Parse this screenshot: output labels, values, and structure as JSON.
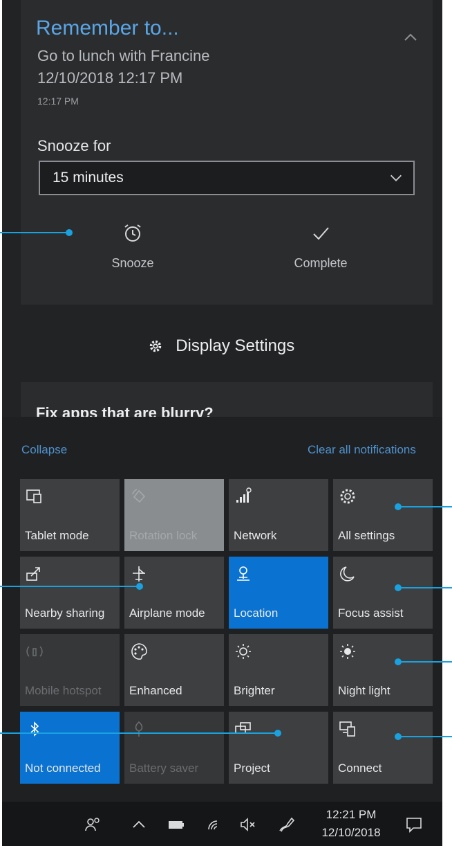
{
  "notification": {
    "title": "Remember to...",
    "line1": "Go to lunch with Francine",
    "line2": "12/10/2018 12:17 PM",
    "time": "12:17 PM",
    "snooze_label": "Snooze for",
    "snooze_value": "15 minutes",
    "actions": {
      "snooze": "Snooze",
      "complete": "Complete"
    }
  },
  "display_settings": {
    "title": "Display Settings",
    "preview": "Fix apps that are blurry?"
  },
  "action_center": {
    "collapse": "Collapse",
    "clear_all": "Clear all notifications",
    "tiles": [
      {
        "label": "Tablet mode",
        "icon": "tablet-mode-icon",
        "state": "off"
      },
      {
        "label": "Rotation lock",
        "icon": "rotation-lock-icon",
        "state": "disabled-light"
      },
      {
        "label": "Network",
        "icon": "network-icon",
        "state": "off"
      },
      {
        "label": "All settings",
        "icon": "gear-icon",
        "state": "off"
      },
      {
        "label": "Nearby sharing",
        "icon": "nearby-sharing-icon",
        "state": "off"
      },
      {
        "label": "Airplane mode",
        "icon": "airplane-icon",
        "state": "off"
      },
      {
        "label": "Location",
        "icon": "location-icon",
        "state": "on"
      },
      {
        "label": "Focus assist",
        "icon": "moon-icon",
        "state": "off"
      },
      {
        "label": "Mobile hotspot",
        "icon": "hotspot-icon",
        "state": "disabled"
      },
      {
        "label": "Enhanced",
        "icon": "palette-icon",
        "state": "off"
      },
      {
        "label": "Brighter",
        "icon": "brightness-icon",
        "state": "off"
      },
      {
        "label": "Night light",
        "icon": "night-light-icon",
        "state": "off"
      },
      {
        "label": "Not connected",
        "icon": "bluetooth-icon",
        "state": "on"
      },
      {
        "label": "Battery saver",
        "icon": "battery-saver-icon",
        "state": "disabled"
      },
      {
        "label": "Project",
        "icon": "project-icon",
        "state": "off"
      },
      {
        "label": "Connect",
        "icon": "connect-icon",
        "state": "off"
      }
    ]
  },
  "taskbar": {
    "clock_time": "12:21 PM",
    "clock_date": "12/10/2018"
  },
  "colors": {
    "accent": "#0a72d0",
    "link": "#4f92cf",
    "title_blue": "#5aa6e6",
    "callout": "#1aa1e0"
  }
}
